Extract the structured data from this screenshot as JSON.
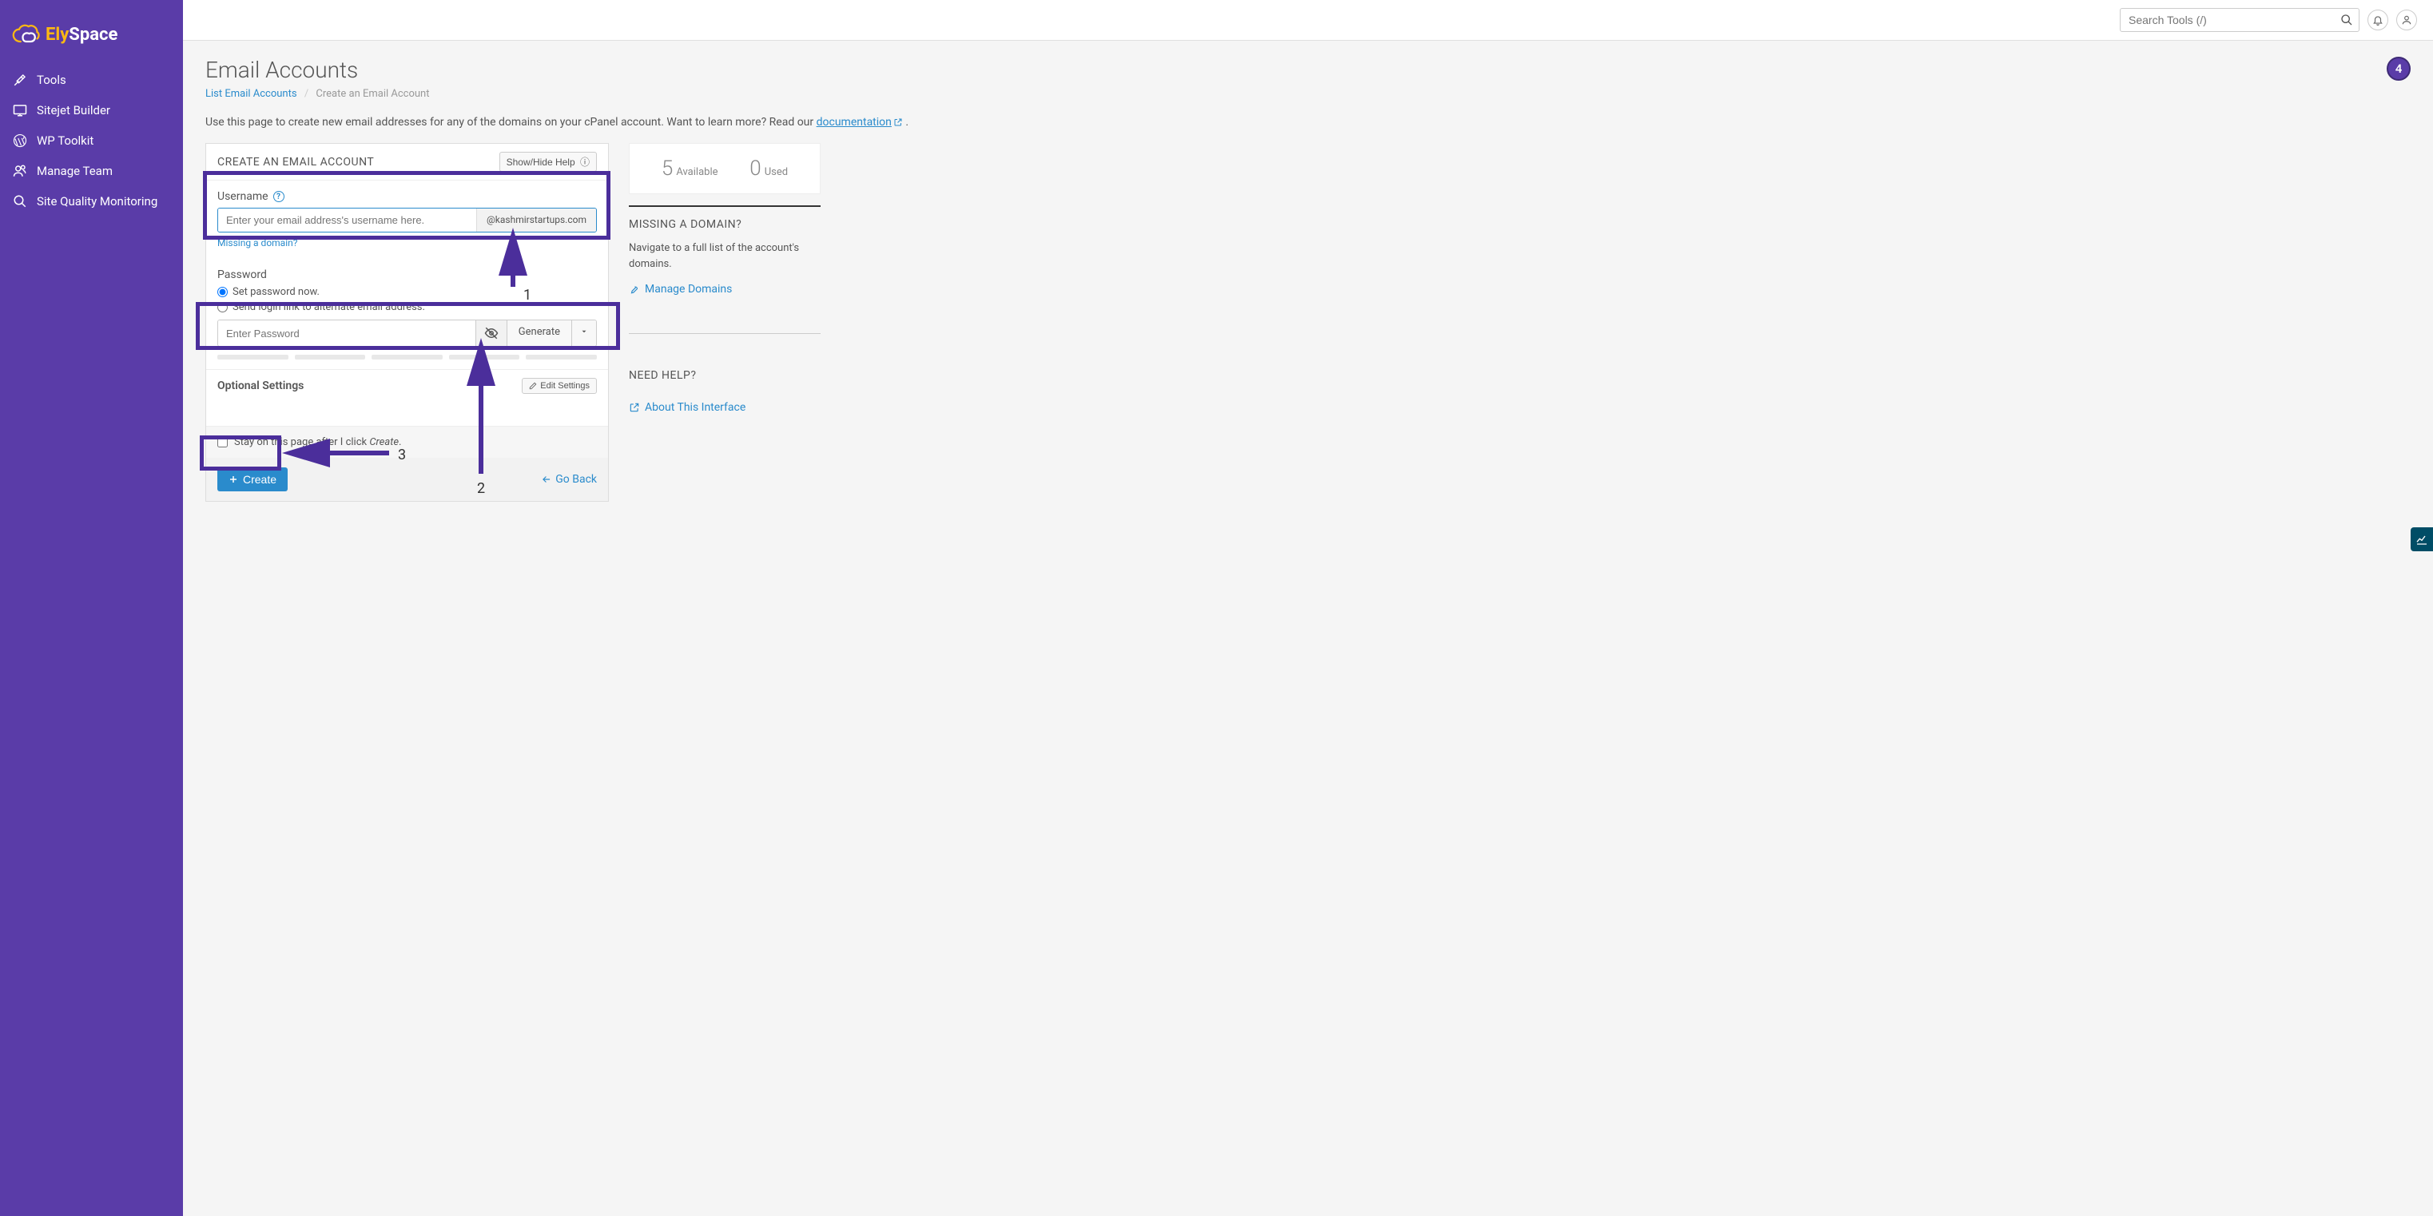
{
  "brand": {
    "part1": "Ely",
    "part2": "Space"
  },
  "sidebar": {
    "items": [
      {
        "label": "Tools",
        "icon": "wrench-icon"
      },
      {
        "label": "Sitejet Builder",
        "icon": "screen-icon"
      },
      {
        "label": "WP Toolkit",
        "icon": "wordpress-icon"
      },
      {
        "label": "Manage Team",
        "icon": "team-icon"
      },
      {
        "label": "Site Quality Monitoring",
        "icon": "magnify-icon"
      }
    ]
  },
  "topbar": {
    "search_placeholder": "Search Tools (/)"
  },
  "page": {
    "title": "Email Accounts",
    "breadcrumb_list": "List Email Accounts",
    "breadcrumb_current": "Create an Email Account",
    "badge": "4",
    "intro_prefix": "Use this page to create new email addresses for any of the domains on your cPanel account. Want to learn more? Read our ",
    "intro_link": "documentation",
    "intro_suffix": " ."
  },
  "form": {
    "panel_title": "CREATE AN EMAIL ACCOUNT",
    "help_btn": "Show/Hide Help",
    "username_label": "Username",
    "username_placeholder": "Enter your email address's username here.",
    "domain_addon": "@kashmirstartups.com",
    "missing_domain": "Missing a domain?",
    "password_label": "Password",
    "radio_now": "Set password now.",
    "radio_link": "Send login link to alternate email address.",
    "password_placeholder": "Enter Password",
    "generate_btn": "Generate",
    "optional_title": "Optional Settings",
    "edit_settings": "Edit Settings",
    "stay_prefix": "Stay on this page after I click ",
    "stay_italic": "Create",
    "stay_suffix": ".",
    "create_btn": "Create",
    "goback": "Go Back"
  },
  "stats": {
    "available_num": "5",
    "available_label": "Available",
    "used_num": "0",
    "used_label": "Used"
  },
  "side": {
    "missing_title": "MISSING A DOMAIN?",
    "missing_text": "Navigate to a full list of the account's domains.",
    "manage_domains": "Manage Domains",
    "help_title": "NEED HELP?",
    "about_interface": "About This Interface"
  },
  "annotations": {
    "n1": "1",
    "n2": "2",
    "n3": "3"
  }
}
